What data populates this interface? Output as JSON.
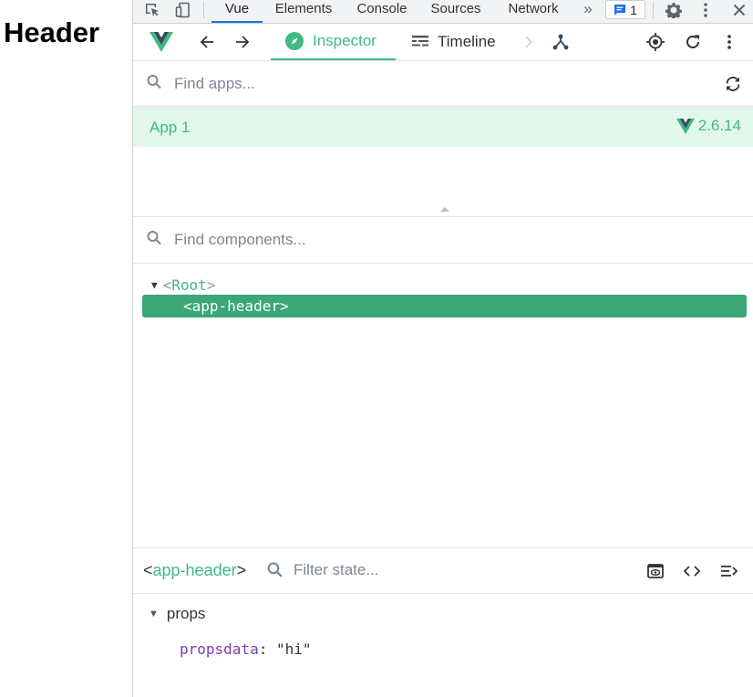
{
  "page": {
    "heading": "Header"
  },
  "devtools_tabs": {
    "items": [
      "Vue",
      "Elements",
      "Console",
      "Sources",
      "Network"
    ],
    "more": "»",
    "issues_count": "1"
  },
  "vue_toolbar": {
    "inspector_label": "Inspector",
    "timeline_label": "Timeline"
  },
  "apps_search": {
    "placeholder": "Find apps..."
  },
  "app_list": [
    {
      "name": "App 1",
      "version": "2.6.14"
    }
  ],
  "components_search": {
    "placeholder": "Find components..."
  },
  "component_tree": {
    "root": {
      "open": "<",
      "name": "Root",
      "close": ">"
    },
    "selected": "<app-header>"
  },
  "inspector": {
    "component_open": "<",
    "component_name": "app-header",
    "component_close": ">",
    "filter_placeholder": "Filter state...",
    "section_title": "props",
    "props": [
      {
        "key": "propsdata",
        "colon": ": ",
        "value": "\"hi\""
      }
    ]
  },
  "colors": {
    "vue_green": "#42b883",
    "selected_row": "#3ba776",
    "app_row_bg": "#e1f7ec",
    "devtools_active_tab": "#1a73e8"
  }
}
